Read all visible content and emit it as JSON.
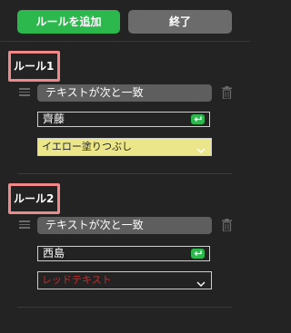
{
  "toolbar": {
    "add_rule_label": "ルールを追加",
    "end_label": "終了"
  },
  "rules": [
    {
      "title": "ルール1",
      "condition": "テキストが次と一致",
      "value": "齊藤",
      "style": "イエロー塗りつぶし"
    },
    {
      "title": "ルール2",
      "condition": "テキストが次と一致",
      "value": "西島",
      "style": "レッドテキスト"
    }
  ],
  "colors": {
    "background": "#232323",
    "accent_green": "#2db84d",
    "button_gray": "#6b6b6b",
    "highlight_yellow": "#ece68a",
    "text_red": "#c62b2b",
    "title_outline": "#f08a8a"
  },
  "icons": {
    "drag": "drag-handle-icon",
    "trash": "trash-icon",
    "enter": "enter-return-icon",
    "chevron": "chevron-down-icon"
  }
}
